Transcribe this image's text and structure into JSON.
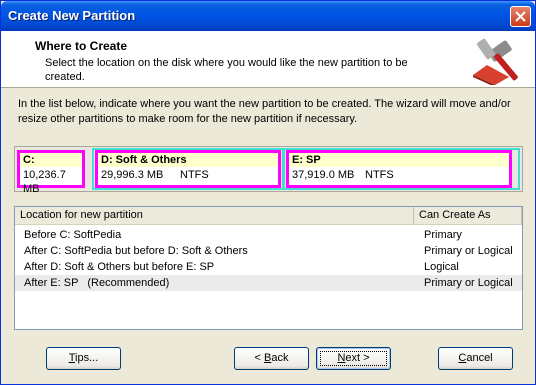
{
  "window": {
    "title": "Create New Partition"
  },
  "header": {
    "title": "Where to Create",
    "description": "Select the location on the disk where you would like the new partition to be created."
  },
  "intro": "In the list below, indicate where you want the new partition to be created. The wizard will move and/or resize other partitions to make room for the new partition if necessary.",
  "partitions": [
    {
      "label": "C:",
      "size": "10,236.7 MB",
      "fs": ""
    },
    {
      "label": "D:  Soft & Others",
      "size": "29,996.3 MB",
      "fs": "NTFS"
    },
    {
      "label": "E:  SP",
      "size": "37,919.0 MB",
      "fs": "NTFS"
    }
  ],
  "list": {
    "columns": [
      "Location for new partition",
      "Can Create As"
    ],
    "rows": [
      {
        "location": "Before C: SoftPedia",
        "type": "Primary"
      },
      {
        "location": "After C: SoftPedia but before D: Soft & Others",
        "type": "Primary or Logical"
      },
      {
        "location": "After D: Soft & Others but before E: SP",
        "type": "Logical"
      },
      {
        "location": "After E: SP   (Recommended)",
        "type": "Primary or Logical"
      }
    ],
    "selected_index": 3
  },
  "buttons": {
    "tips": {
      "mnemonic": "T",
      "rest": "ips..."
    },
    "back": {
      "prefix": "< ",
      "mnemonic": "B",
      "rest": "ack"
    },
    "next": {
      "mnemonic": "N",
      "rest": "ext >"
    },
    "cancel": {
      "mnemonic": "C",
      "rest": "ancel"
    }
  },
  "icons": {
    "close": "close-icon",
    "header": "hammer-icon"
  },
  "colors": {
    "partition_border": "#ff00ff",
    "partition_outer": "#40e0d0",
    "title_bar": "#0055e5"
  }
}
